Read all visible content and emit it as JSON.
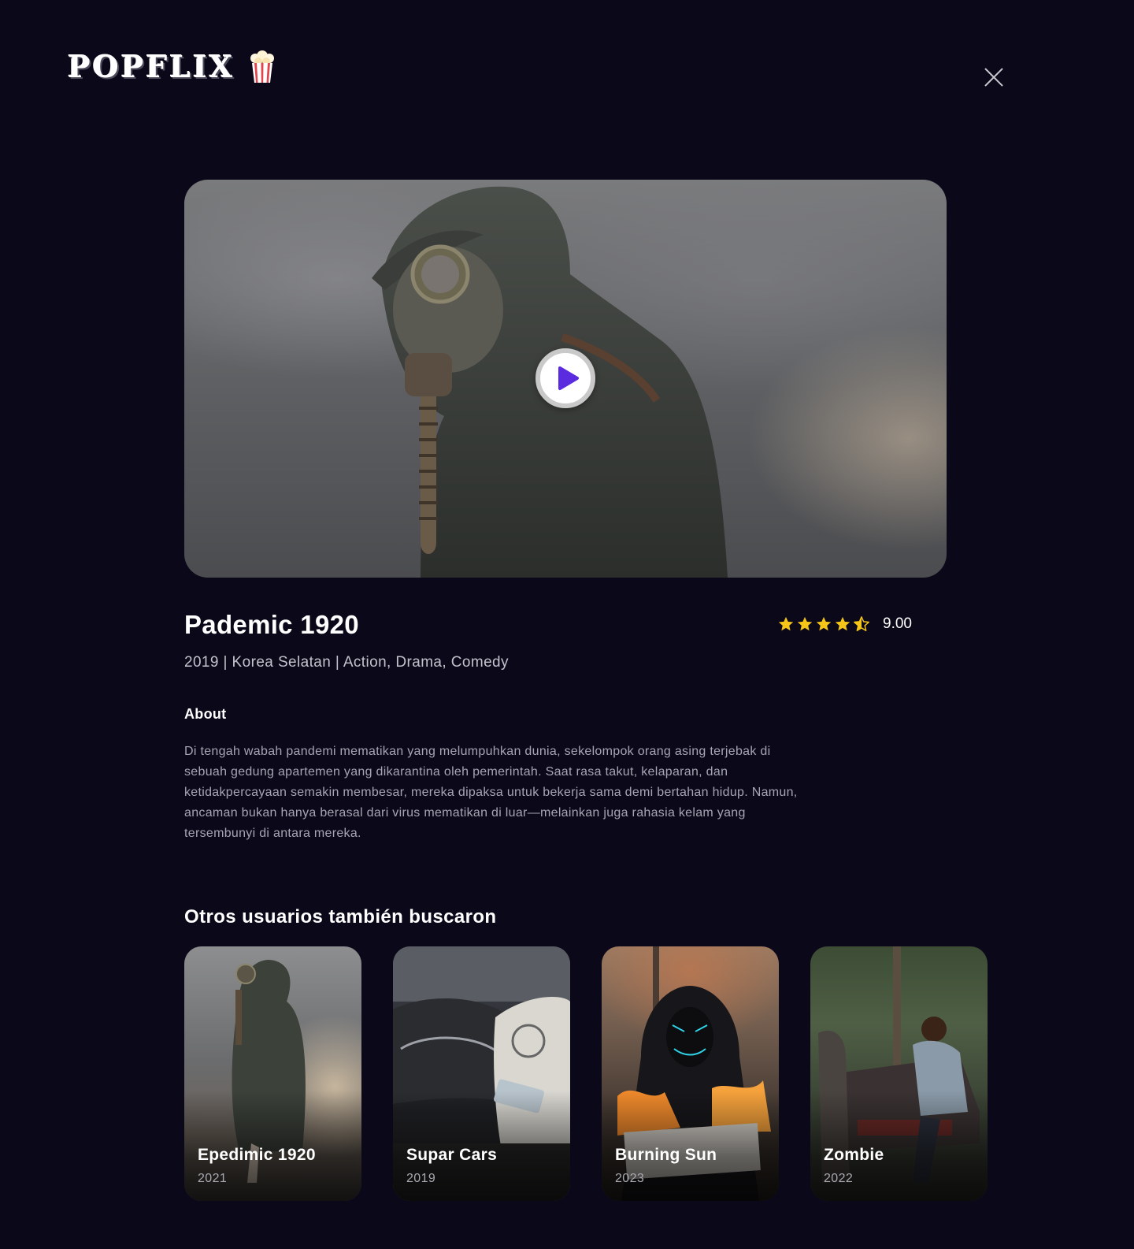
{
  "header": {
    "logo_text": "POPFLIX",
    "logo_icon": "popcorn-icon",
    "close_icon": "close-icon"
  },
  "hero": {
    "play_icon": "play-icon",
    "accent_color": "#5b2be0"
  },
  "movie": {
    "title": "Pademic 1920",
    "year": "2019",
    "country": "Korea Selatan",
    "genres": "Action, Drama, Comedy",
    "meta_line": "2019 | Korea Selatan | Action, Drama, Comedy",
    "rating_value": "9.00",
    "rating_stars": 4.5,
    "star_color": "#f5c518"
  },
  "about": {
    "heading": "About",
    "text": "Di tengah wabah pandemi mematikan yang melumpuhkan dunia, sekelompok orang asing terjebak di sebuah gedung apartemen yang dikarantina oleh pemerintah. Saat rasa takut, kelaparan, dan ketidakpercayaan semakin membesar, mereka dipaksa untuk bekerja sama demi bertahan hidup. Namun, ancaman bukan hanya berasal dari virus mematikan di luar—melainkan juga rahasia kelam yang tersembunyi di antara mereka."
  },
  "related": {
    "heading": "Otros usuarios también buscaron",
    "items": [
      {
        "title": "Epedimic 1920",
        "year": "2021"
      },
      {
        "title": "Supar Cars",
        "year": "2019"
      },
      {
        "title": "Burning Sun",
        "year": "2023"
      },
      {
        "title": "Zombie",
        "year": "2022"
      }
    ]
  },
  "colors": {
    "background": "#0b0919",
    "muted_text": "#a6a5b3"
  }
}
